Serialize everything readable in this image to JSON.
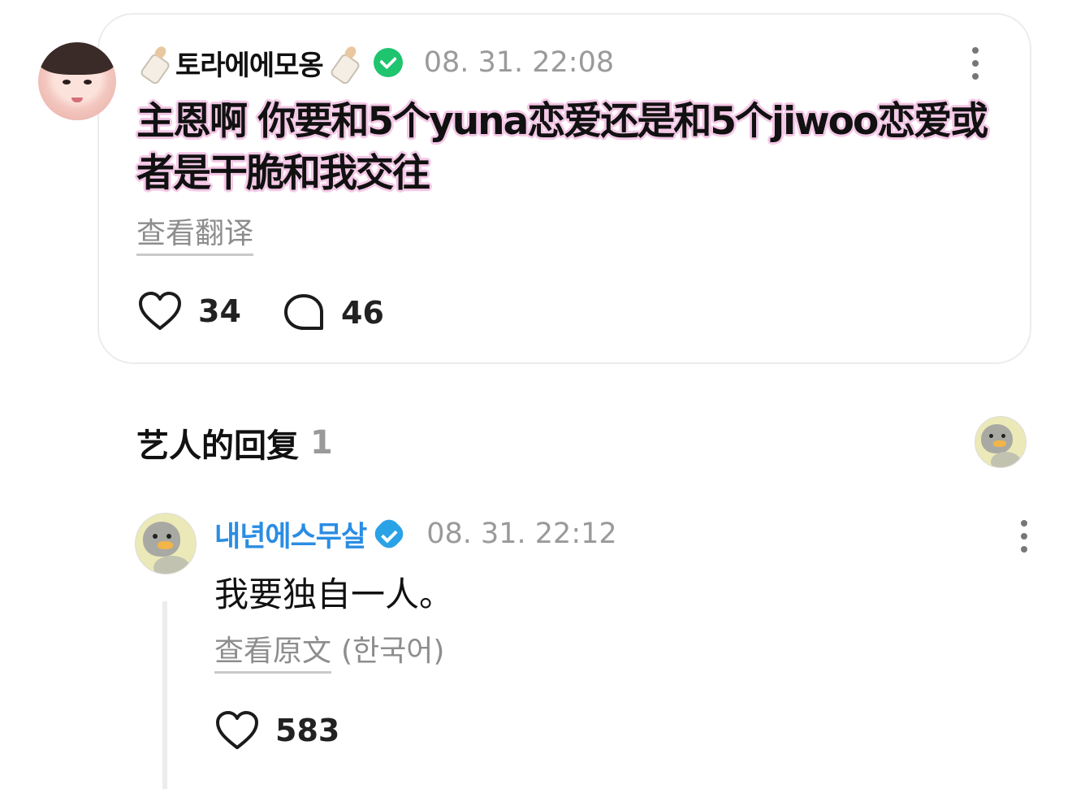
{
  "post": {
    "username": "토라에에모옹",
    "timestamp": "08. 31. 22:08",
    "text": "主恩啊 你要和5个yuna恋爱还是和5个jiwoo恋爱或者是干脆和我交往",
    "translate_link": "查看翻译",
    "likes": "34",
    "comments": "46",
    "icons": [
      "baby-bottle-icon",
      "verified-green-icon",
      "more-vertical-icon",
      "heart-icon",
      "comment-bubble-icon"
    ]
  },
  "artist_replies": {
    "title": "艺人的回复",
    "count": "1"
  },
  "reply": {
    "username": "내년에스무살",
    "timestamp": "08. 31. 22:12",
    "text": "我要独自一人。",
    "original_link": "查看原文",
    "original_lang": "(한국어)",
    "likes": "583",
    "accent_color": "#2a8de3"
  }
}
